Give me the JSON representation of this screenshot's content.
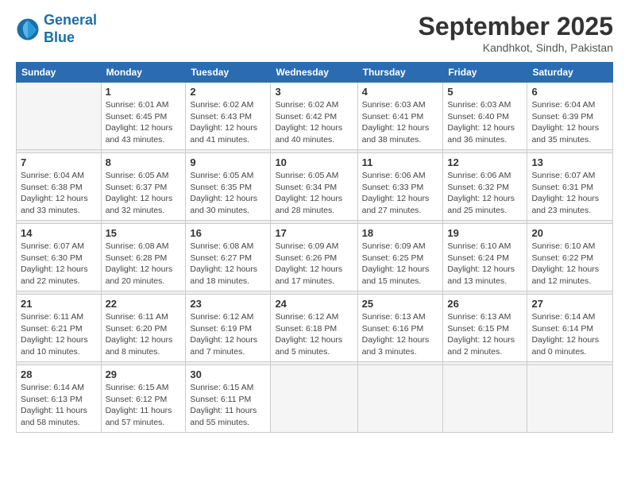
{
  "logo": {
    "line1": "General",
    "line2": "Blue"
  },
  "title": "September 2025",
  "location": "Kandhkot, Sindh, Pakistan",
  "days_of_week": [
    "Sunday",
    "Monday",
    "Tuesday",
    "Wednesday",
    "Thursday",
    "Friday",
    "Saturday"
  ],
  "weeks": [
    [
      {
        "day": "",
        "info": ""
      },
      {
        "day": "1",
        "info": "Sunrise: 6:01 AM\nSunset: 6:45 PM\nDaylight: 12 hours\nand 43 minutes."
      },
      {
        "day": "2",
        "info": "Sunrise: 6:02 AM\nSunset: 6:43 PM\nDaylight: 12 hours\nand 41 minutes."
      },
      {
        "day": "3",
        "info": "Sunrise: 6:02 AM\nSunset: 6:42 PM\nDaylight: 12 hours\nand 40 minutes."
      },
      {
        "day": "4",
        "info": "Sunrise: 6:03 AM\nSunset: 6:41 PM\nDaylight: 12 hours\nand 38 minutes."
      },
      {
        "day": "5",
        "info": "Sunrise: 6:03 AM\nSunset: 6:40 PM\nDaylight: 12 hours\nand 36 minutes."
      },
      {
        "day": "6",
        "info": "Sunrise: 6:04 AM\nSunset: 6:39 PM\nDaylight: 12 hours\nand 35 minutes."
      }
    ],
    [
      {
        "day": "7",
        "info": "Sunrise: 6:04 AM\nSunset: 6:38 PM\nDaylight: 12 hours\nand 33 minutes."
      },
      {
        "day": "8",
        "info": "Sunrise: 6:05 AM\nSunset: 6:37 PM\nDaylight: 12 hours\nand 32 minutes."
      },
      {
        "day": "9",
        "info": "Sunrise: 6:05 AM\nSunset: 6:35 PM\nDaylight: 12 hours\nand 30 minutes."
      },
      {
        "day": "10",
        "info": "Sunrise: 6:05 AM\nSunset: 6:34 PM\nDaylight: 12 hours\nand 28 minutes."
      },
      {
        "day": "11",
        "info": "Sunrise: 6:06 AM\nSunset: 6:33 PM\nDaylight: 12 hours\nand 27 minutes."
      },
      {
        "day": "12",
        "info": "Sunrise: 6:06 AM\nSunset: 6:32 PM\nDaylight: 12 hours\nand 25 minutes."
      },
      {
        "day": "13",
        "info": "Sunrise: 6:07 AM\nSunset: 6:31 PM\nDaylight: 12 hours\nand 23 minutes."
      }
    ],
    [
      {
        "day": "14",
        "info": "Sunrise: 6:07 AM\nSunset: 6:30 PM\nDaylight: 12 hours\nand 22 minutes."
      },
      {
        "day": "15",
        "info": "Sunrise: 6:08 AM\nSunset: 6:28 PM\nDaylight: 12 hours\nand 20 minutes."
      },
      {
        "day": "16",
        "info": "Sunrise: 6:08 AM\nSunset: 6:27 PM\nDaylight: 12 hours\nand 18 minutes."
      },
      {
        "day": "17",
        "info": "Sunrise: 6:09 AM\nSunset: 6:26 PM\nDaylight: 12 hours\nand 17 minutes."
      },
      {
        "day": "18",
        "info": "Sunrise: 6:09 AM\nSunset: 6:25 PM\nDaylight: 12 hours\nand 15 minutes."
      },
      {
        "day": "19",
        "info": "Sunrise: 6:10 AM\nSunset: 6:24 PM\nDaylight: 12 hours\nand 13 minutes."
      },
      {
        "day": "20",
        "info": "Sunrise: 6:10 AM\nSunset: 6:22 PM\nDaylight: 12 hours\nand 12 minutes."
      }
    ],
    [
      {
        "day": "21",
        "info": "Sunrise: 6:11 AM\nSunset: 6:21 PM\nDaylight: 12 hours\nand 10 minutes."
      },
      {
        "day": "22",
        "info": "Sunrise: 6:11 AM\nSunset: 6:20 PM\nDaylight: 12 hours\nand 8 minutes."
      },
      {
        "day": "23",
        "info": "Sunrise: 6:12 AM\nSunset: 6:19 PM\nDaylight: 12 hours\nand 7 minutes."
      },
      {
        "day": "24",
        "info": "Sunrise: 6:12 AM\nSunset: 6:18 PM\nDaylight: 12 hours\nand 5 minutes."
      },
      {
        "day": "25",
        "info": "Sunrise: 6:13 AM\nSunset: 6:16 PM\nDaylight: 12 hours\nand 3 minutes."
      },
      {
        "day": "26",
        "info": "Sunrise: 6:13 AM\nSunset: 6:15 PM\nDaylight: 12 hours\nand 2 minutes."
      },
      {
        "day": "27",
        "info": "Sunrise: 6:14 AM\nSunset: 6:14 PM\nDaylight: 12 hours\nand 0 minutes."
      }
    ],
    [
      {
        "day": "28",
        "info": "Sunrise: 6:14 AM\nSunset: 6:13 PM\nDaylight: 11 hours\nand 58 minutes."
      },
      {
        "day": "29",
        "info": "Sunrise: 6:15 AM\nSunset: 6:12 PM\nDaylight: 11 hours\nand 57 minutes."
      },
      {
        "day": "30",
        "info": "Sunrise: 6:15 AM\nSunset: 6:11 PM\nDaylight: 11 hours\nand 55 minutes."
      },
      {
        "day": "",
        "info": ""
      },
      {
        "day": "",
        "info": ""
      },
      {
        "day": "",
        "info": ""
      },
      {
        "day": "",
        "info": ""
      }
    ]
  ]
}
